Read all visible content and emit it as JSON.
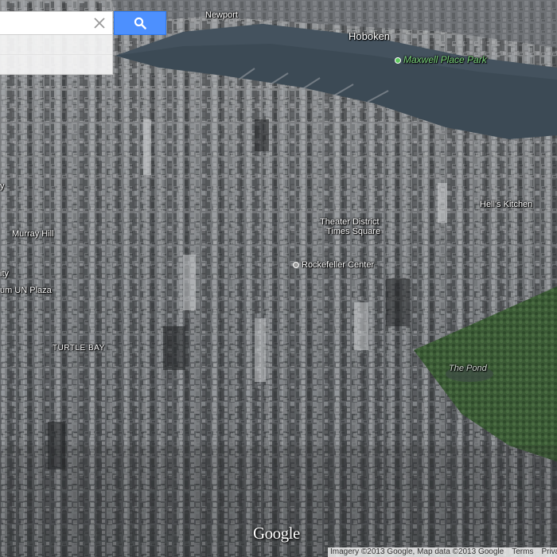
{
  "search": {
    "value": "",
    "clear_icon": "close-icon",
    "button_icon": "search-icon",
    "button_color": "#4d90fe"
  },
  "labels": {
    "newport": "Newport",
    "hoboken": "Hoboken",
    "maxwell_place_park": "Maxwell Place Park",
    "theater_district": "Theater District",
    "times_square": "Times Square",
    "hells_kitchen": "Hell's Kitchen",
    "murray_hill": "Murray Hill",
    "rockefeller_center": "Rockefeller Center",
    "un_plaza": "um UN Plaza",
    "turtle_bay": "TURTLE BAY",
    "the_pond": "The Pond",
    "left_edge_y": "y",
    "left_edge_ity": "ity"
  },
  "colors": {
    "park_poi": "#5ec95e",
    "place_poi": "#9e9e9e",
    "water": "#3c4a55",
    "park_area": "#3c5a36"
  },
  "branding": {
    "logo": "Google"
  },
  "footer": {
    "imagery": "Imagery ©2013 Google, Map data ©2013 Google",
    "terms": "Terms",
    "privacy": "Privacy"
  }
}
